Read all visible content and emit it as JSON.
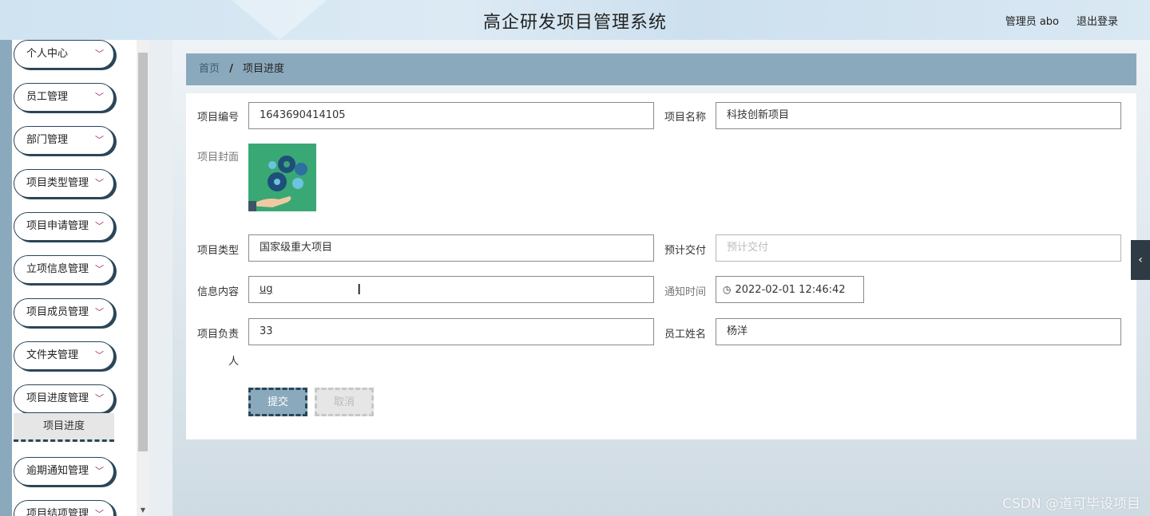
{
  "header": {
    "title": "高企研发项目管理系统",
    "user": "管理员 abo",
    "logout": "退出登录"
  },
  "sidebar": {
    "items": [
      {
        "label": "个人中心"
      },
      {
        "label": "员工管理"
      },
      {
        "label": "部门管理"
      },
      {
        "label": "项目类型管理"
      },
      {
        "label": "项目申请管理"
      },
      {
        "label": "立项信息管理"
      },
      {
        "label": "项目成员管理"
      },
      {
        "label": "文件夹管理"
      },
      {
        "label": "项目进度管理"
      },
      {
        "label": "逾期通知管理"
      },
      {
        "label": "项目结项管理"
      }
    ],
    "active_sub": "项目进度",
    "chevron": "chevron-down-icon"
  },
  "breadcrumb": {
    "home": "首页",
    "separator": "/",
    "current": "项目进度"
  },
  "form": {
    "project_no_label": "项目编号",
    "project_no": "1643690414105",
    "project_name_label": "项目名称",
    "project_name": "科技创新项目",
    "cover_label": "项目封面",
    "type_label": "项目类型",
    "type": "国家级重大项目",
    "delivery_label": "预计交付",
    "delivery_placeholder": "预计交付",
    "info_label": "信息内容",
    "info": "ug",
    "notify_label": "通知时间",
    "notify_time": "2022-02-01 12:46:42",
    "leader_label_1": "项目负责",
    "leader_label_2": "人",
    "leader": "33",
    "employee_label": "员工姓名",
    "employee": "杨洋",
    "submit": "提交",
    "cancel": "取消"
  },
  "watermark": "CSDN @道可毕设项目",
  "colors": {
    "accent": "#8ba9bd",
    "dark": "#2b4658",
    "chevron": "#a0285a"
  }
}
